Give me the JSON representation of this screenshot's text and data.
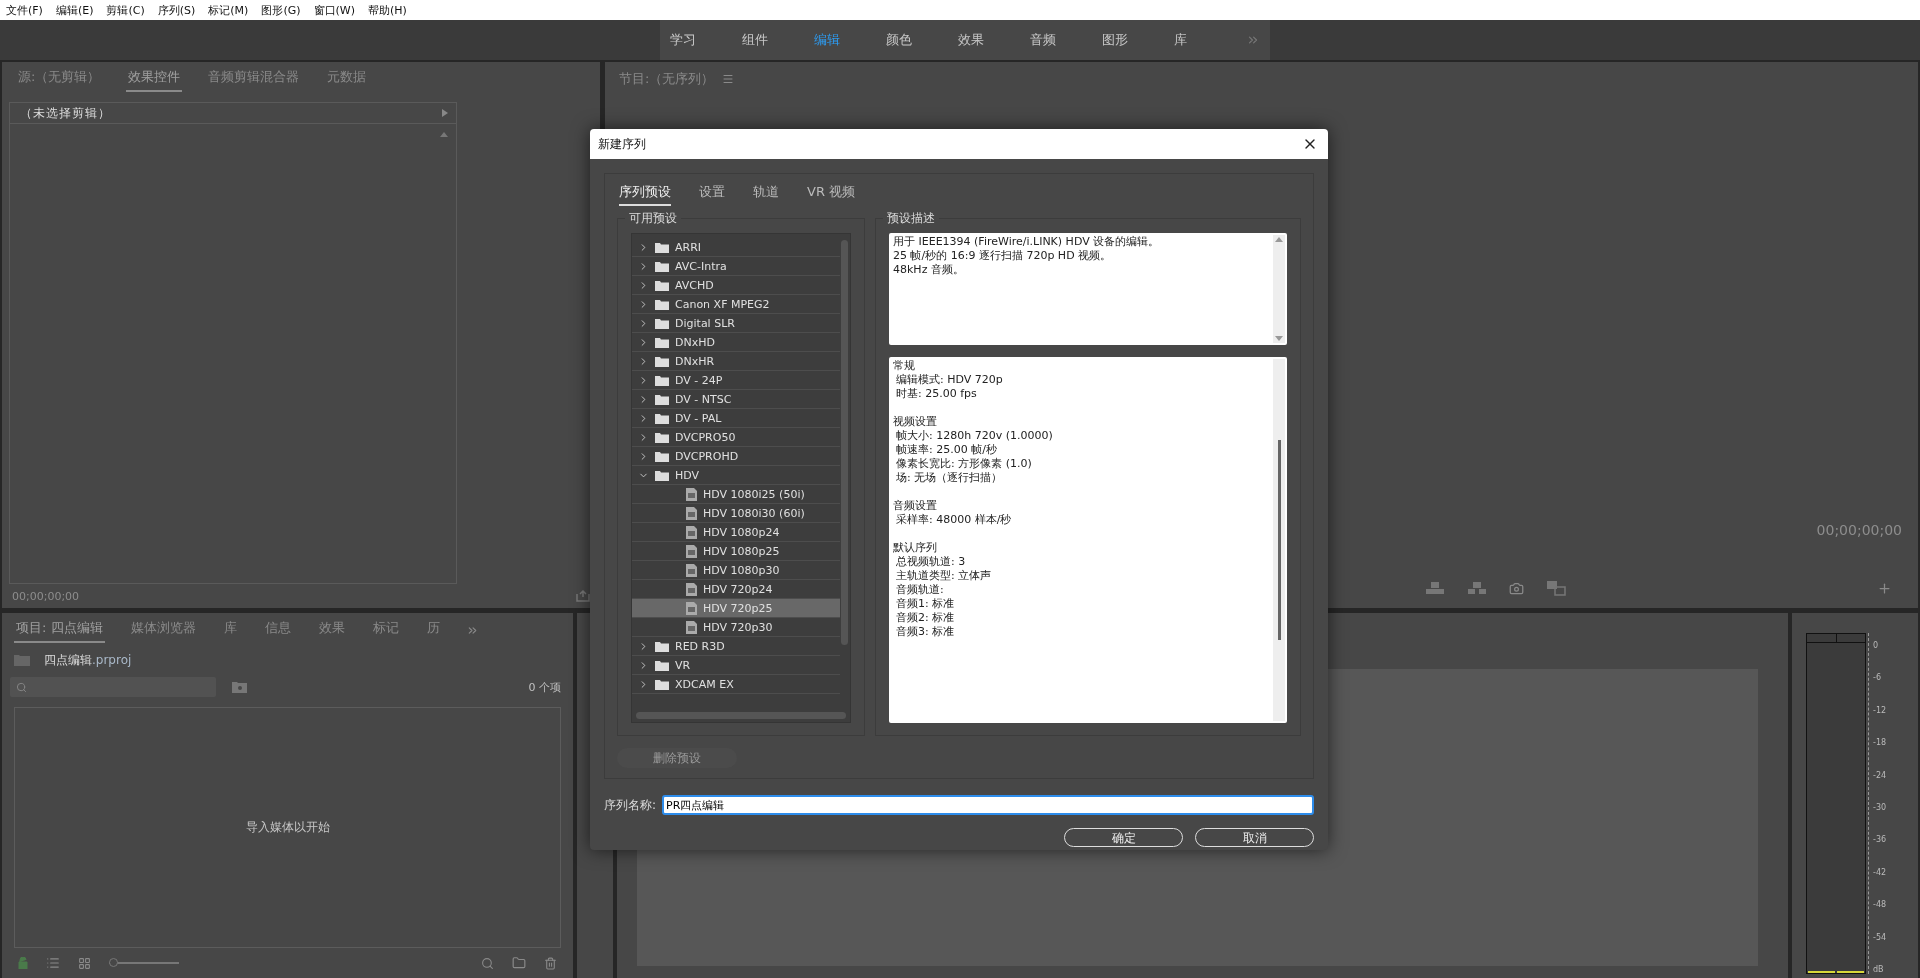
{
  "menu_bar": [
    "文件(F)",
    "编辑(E)",
    "剪辑(C)",
    "序列(S)",
    "标记(M)",
    "图形(G)",
    "窗口(W)",
    "帮助(H)"
  ],
  "workspaces": [
    {
      "label": "学习",
      "selected": false
    },
    {
      "label": "组件",
      "selected": false
    },
    {
      "label": "编辑",
      "selected": true
    },
    {
      "label": "颜色",
      "selected": false
    },
    {
      "label": "效果",
      "selected": false
    },
    {
      "label": "音频",
      "selected": false
    },
    {
      "label": "图形",
      "selected": false
    },
    {
      "label": "库",
      "selected": false
    }
  ],
  "source_panel": {
    "tabs": [
      {
        "label": "源:（无剪辑）",
        "selected": false
      },
      {
        "label": "效果控件",
        "selected": true
      },
      {
        "label": "音频剪辑混合器",
        "selected": false
      },
      {
        "label": "元数据",
        "selected": false
      }
    ],
    "clip_header": "（未选择剪辑）",
    "timecode": "00;00;00;00"
  },
  "program_panel": {
    "title": "节目:（无序列）",
    "timecode": "00;00;00;00"
  },
  "project_panel": {
    "tabs": [
      {
        "label": "项目: 四点编辑",
        "selected": true
      },
      {
        "label": "媒体浏览器",
        "selected": false
      },
      {
        "label": "库",
        "selected": false
      },
      {
        "label": "信息",
        "selected": false
      },
      {
        "label": "效果",
        "selected": false
      },
      {
        "label": "标记",
        "selected": false
      },
      {
        "label": "历",
        "selected": false
      }
    ],
    "file_name": "四点编辑",
    "file_extension": ".prproj",
    "item_count": "0 个项",
    "zoom_slider": {
      "level": 0
    },
    "empty_message": "导入媒体以开始"
  },
  "audio_meter": {
    "scale": [
      "0",
      "-6",
      "-12",
      "-18",
      "-24",
      "-30",
      "-36",
      "-42",
      "-48",
      "-54",
      "dB"
    ]
  },
  "dialog": {
    "title": "新建序列",
    "tabs": [
      {
        "label": "序列预设",
        "selected": true
      },
      {
        "label": "设置",
        "selected": false
      },
      {
        "label": "轨道",
        "selected": false
      },
      {
        "label": "VR 视频",
        "selected": false
      }
    ],
    "presets_label": "可用预设",
    "presets": [
      {
        "label": "ARRI",
        "kind": "folder",
        "expanded": false
      },
      {
        "label": "AVC-Intra",
        "kind": "folder",
        "expanded": false
      },
      {
        "label": "AVCHD",
        "kind": "folder",
        "expanded": false
      },
      {
        "label": "Canon XF MPEG2",
        "kind": "folder",
        "expanded": false
      },
      {
        "label": "Digital SLR",
        "kind": "folder",
        "expanded": false
      },
      {
        "label": "DNxHD",
        "kind": "folder",
        "expanded": false
      },
      {
        "label": "DNxHR",
        "kind": "folder",
        "expanded": false
      },
      {
        "label": "DV - 24P",
        "kind": "folder",
        "expanded": false
      },
      {
        "label": "DV - NTSC",
        "kind": "folder",
        "expanded": false
      },
      {
        "label": "DV - PAL",
        "kind": "folder",
        "expanded": false
      },
      {
        "label": "DVCPRO50",
        "kind": "folder",
        "expanded": false
      },
      {
        "label": "DVCPROHD",
        "kind": "folder",
        "expanded": false
      },
      {
        "label": "HDV",
        "kind": "folder",
        "expanded": true,
        "children": [
          {
            "label": "HDV 1080i25 (50i)",
            "kind": "preset",
            "selected": false
          },
          {
            "label": "HDV 1080i30 (60i)",
            "kind": "preset",
            "selected": false
          },
          {
            "label": "HDV 1080p24",
            "kind": "preset",
            "selected": false
          },
          {
            "label": "HDV 1080p25",
            "kind": "preset",
            "selected": false
          },
          {
            "label": "HDV 1080p30",
            "kind": "preset",
            "selected": false
          },
          {
            "label": "HDV 720p24",
            "kind": "preset",
            "selected": false
          },
          {
            "label": "HDV 720p25",
            "kind": "preset",
            "selected": true
          },
          {
            "label": "HDV 720p30",
            "kind": "preset",
            "selected": false
          }
        ]
      },
      {
        "label": "RED R3D",
        "kind": "folder",
        "expanded": false
      },
      {
        "label": "VR",
        "kind": "folder",
        "expanded": false
      },
      {
        "label": "XDCAM EX",
        "kind": "folder",
        "expanded": false
      }
    ],
    "delete_button": {
      "label": "删除预设",
      "disabled": true
    },
    "description_label": "预设描述",
    "description": [
      "用于 IEEE1394 (FireWire/i.LINK) HDV 设备的编辑。",
      "25 帧/秒的 16:9 逐行扫描 720p HD 视频。",
      "48kHz 音频。"
    ],
    "details": [
      {
        "heading": "常规",
        "lines": [
          "编辑模式: HDV 720p",
          "时基: 25.00 fps"
        ]
      },
      {
        "heading": "视频设置",
        "lines": [
          "帧大小: 1280h 720v (1.0000)",
          "帧速率: 25.00  帧/秒",
          "像素长宽比: 方形像素 (1.0)",
          "场: 无场（逐行扫描）"
        ]
      },
      {
        "heading": "音频设置",
        "lines": [
          "采样率: 48000 样本/秒"
        ]
      },
      {
        "heading": "默认序列",
        "lines": [
          "总视频轨道: 3",
          "主轨道类型: 立体声",
          "音频轨道:",
          "音频1: 标准",
          "音频2: 标准",
          "音频3: 标准"
        ]
      }
    ],
    "name_label": "序列名称:",
    "name_value": "PR四点编辑",
    "ok_button": "确定",
    "cancel_button": "取消"
  }
}
